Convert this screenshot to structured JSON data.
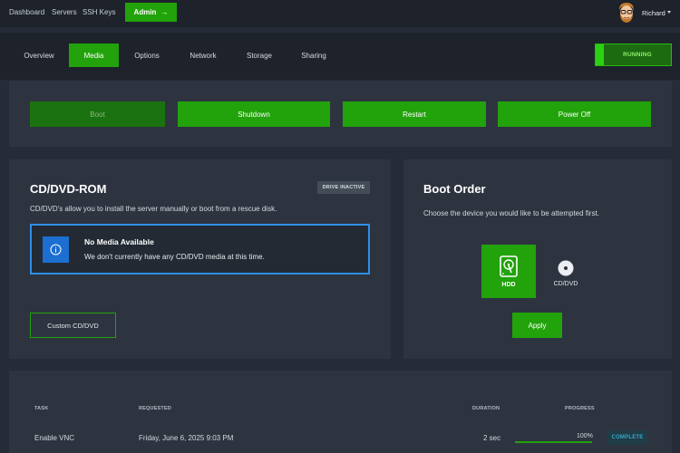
{
  "topnav": {
    "links": [
      "Dashboard",
      "Servers",
      "SSH Keys"
    ],
    "admin_label": "Admin",
    "admin_icon": "arrow-right-icon",
    "user_name": "Richard"
  },
  "tabs": {
    "items": [
      "Overview",
      "Media",
      "Options",
      "Network",
      "Storage",
      "Sharing"
    ],
    "active": "Media"
  },
  "status": {
    "label": "RUNNING",
    "color": "#2bd014"
  },
  "power": {
    "buttons": [
      "Boot",
      "Shutdown",
      "Restart",
      "Power Off"
    ],
    "disabled": "Boot"
  },
  "cdrom": {
    "title": "CD/DVD-ROM",
    "badge": "DRIVE INACTIVE",
    "description": "CD/DVD's allow you to install the server manually or boot from a rescue disk.",
    "alert_title": "No Media Available",
    "alert_text": "We don't currently have any CD/DVD media at this time.",
    "custom_button": "Custom CD/DVD"
  },
  "boot_order": {
    "title": "Boot Order",
    "description": "Choose the device you would like to be attempted first.",
    "devices": [
      "HDD",
      "CD/DVD"
    ],
    "selected": "HDD",
    "apply_label": "Apply"
  },
  "tasks": {
    "columns": [
      "TASK",
      "REQUESTED",
      "DURATION",
      "PROGRESS"
    ],
    "rows": [
      {
        "task": "Enable VNC",
        "requested": "Friday, June 6, 2025 9:03 PM",
        "duration": "2 sec",
        "progress": "100%",
        "progress_value": 1.0,
        "status": "COMPLETE"
      }
    ]
  },
  "colors": {
    "accent": "#22a20b",
    "info": "#2f8ee6",
    "background": "#252c37",
    "panel": "#2d3440"
  }
}
